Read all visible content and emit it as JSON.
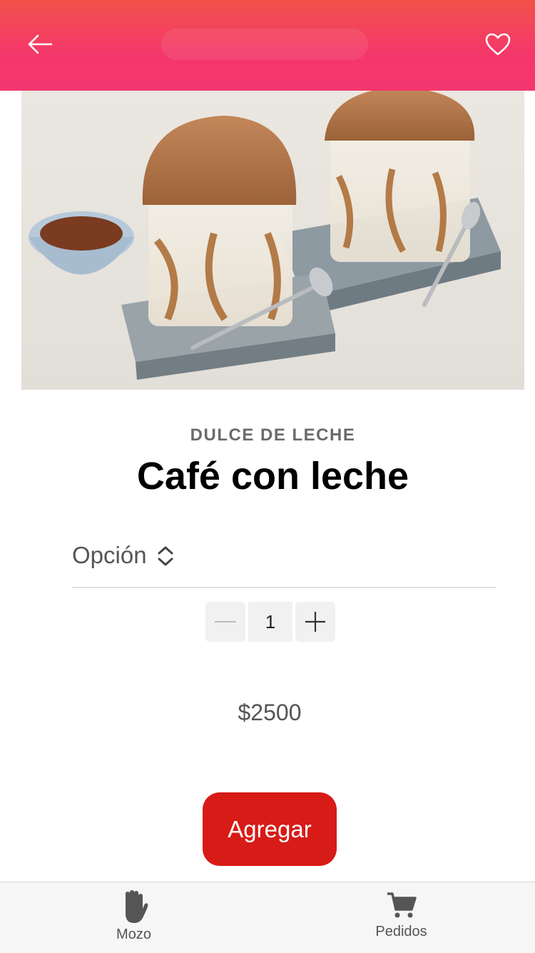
{
  "header": {
    "back_icon": "arrow-left-icon",
    "favorite_icon": "heart-outline-icon",
    "gradient_top": "#f2514a",
    "gradient_bottom": "#f3376f"
  },
  "product": {
    "image_description_icon": "product-photo",
    "category": "DULCE DE LECHE",
    "name": "Café con leche",
    "option_label": "Opción",
    "quantity": "1",
    "price": "$2500",
    "add_label": "Agregar",
    "accent": "#d71b17"
  },
  "bottom_nav": {
    "items": [
      {
        "label": "Mozo",
        "icon": "hand-icon"
      },
      {
        "label": "Pedidos",
        "icon": "cart-icon"
      }
    ]
  }
}
